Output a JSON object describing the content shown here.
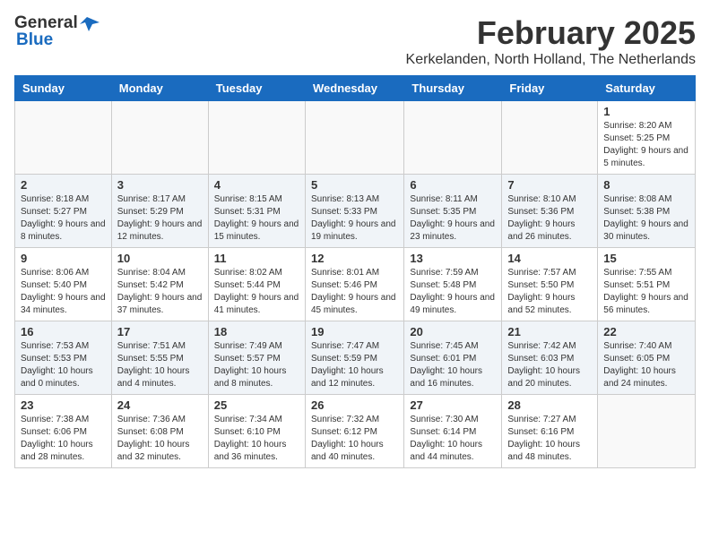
{
  "logo": {
    "general": "General",
    "blue": "Blue"
  },
  "title": {
    "month_year": "February 2025",
    "location": "Kerkelanden, North Holland, The Netherlands"
  },
  "days_of_week": [
    "Sunday",
    "Monday",
    "Tuesday",
    "Wednesday",
    "Thursday",
    "Friday",
    "Saturday"
  ],
  "weeks": [
    [
      {
        "day": "",
        "info": ""
      },
      {
        "day": "",
        "info": ""
      },
      {
        "day": "",
        "info": ""
      },
      {
        "day": "",
        "info": ""
      },
      {
        "day": "",
        "info": ""
      },
      {
        "day": "",
        "info": ""
      },
      {
        "day": "1",
        "info": "Sunrise: 8:20 AM\nSunset: 5:25 PM\nDaylight: 9 hours and 5 minutes."
      }
    ],
    [
      {
        "day": "2",
        "info": "Sunrise: 8:18 AM\nSunset: 5:27 PM\nDaylight: 9 hours and 8 minutes."
      },
      {
        "day": "3",
        "info": "Sunrise: 8:17 AM\nSunset: 5:29 PM\nDaylight: 9 hours and 12 minutes."
      },
      {
        "day": "4",
        "info": "Sunrise: 8:15 AM\nSunset: 5:31 PM\nDaylight: 9 hours and 15 minutes."
      },
      {
        "day": "5",
        "info": "Sunrise: 8:13 AM\nSunset: 5:33 PM\nDaylight: 9 hours and 19 minutes."
      },
      {
        "day": "6",
        "info": "Sunrise: 8:11 AM\nSunset: 5:35 PM\nDaylight: 9 hours and 23 minutes."
      },
      {
        "day": "7",
        "info": "Sunrise: 8:10 AM\nSunset: 5:36 PM\nDaylight: 9 hours and 26 minutes."
      },
      {
        "day": "8",
        "info": "Sunrise: 8:08 AM\nSunset: 5:38 PM\nDaylight: 9 hours and 30 minutes."
      }
    ],
    [
      {
        "day": "9",
        "info": "Sunrise: 8:06 AM\nSunset: 5:40 PM\nDaylight: 9 hours and 34 minutes."
      },
      {
        "day": "10",
        "info": "Sunrise: 8:04 AM\nSunset: 5:42 PM\nDaylight: 9 hours and 37 minutes."
      },
      {
        "day": "11",
        "info": "Sunrise: 8:02 AM\nSunset: 5:44 PM\nDaylight: 9 hours and 41 minutes."
      },
      {
        "day": "12",
        "info": "Sunrise: 8:01 AM\nSunset: 5:46 PM\nDaylight: 9 hours and 45 minutes."
      },
      {
        "day": "13",
        "info": "Sunrise: 7:59 AM\nSunset: 5:48 PM\nDaylight: 9 hours and 49 minutes."
      },
      {
        "day": "14",
        "info": "Sunrise: 7:57 AM\nSunset: 5:50 PM\nDaylight: 9 hours and 52 minutes."
      },
      {
        "day": "15",
        "info": "Sunrise: 7:55 AM\nSunset: 5:51 PM\nDaylight: 9 hours and 56 minutes."
      }
    ],
    [
      {
        "day": "16",
        "info": "Sunrise: 7:53 AM\nSunset: 5:53 PM\nDaylight: 10 hours and 0 minutes."
      },
      {
        "day": "17",
        "info": "Sunrise: 7:51 AM\nSunset: 5:55 PM\nDaylight: 10 hours and 4 minutes."
      },
      {
        "day": "18",
        "info": "Sunrise: 7:49 AM\nSunset: 5:57 PM\nDaylight: 10 hours and 8 minutes."
      },
      {
        "day": "19",
        "info": "Sunrise: 7:47 AM\nSunset: 5:59 PM\nDaylight: 10 hours and 12 minutes."
      },
      {
        "day": "20",
        "info": "Sunrise: 7:45 AM\nSunset: 6:01 PM\nDaylight: 10 hours and 16 minutes."
      },
      {
        "day": "21",
        "info": "Sunrise: 7:42 AM\nSunset: 6:03 PM\nDaylight: 10 hours and 20 minutes."
      },
      {
        "day": "22",
        "info": "Sunrise: 7:40 AM\nSunset: 6:05 PM\nDaylight: 10 hours and 24 minutes."
      }
    ],
    [
      {
        "day": "23",
        "info": "Sunrise: 7:38 AM\nSunset: 6:06 PM\nDaylight: 10 hours and 28 minutes."
      },
      {
        "day": "24",
        "info": "Sunrise: 7:36 AM\nSunset: 6:08 PM\nDaylight: 10 hours and 32 minutes."
      },
      {
        "day": "25",
        "info": "Sunrise: 7:34 AM\nSunset: 6:10 PM\nDaylight: 10 hours and 36 minutes."
      },
      {
        "day": "26",
        "info": "Sunrise: 7:32 AM\nSunset: 6:12 PM\nDaylight: 10 hours and 40 minutes."
      },
      {
        "day": "27",
        "info": "Sunrise: 7:30 AM\nSunset: 6:14 PM\nDaylight: 10 hours and 44 minutes."
      },
      {
        "day": "28",
        "info": "Sunrise: 7:27 AM\nSunset: 6:16 PM\nDaylight: 10 hours and 48 minutes."
      },
      {
        "day": "",
        "info": ""
      }
    ]
  ]
}
